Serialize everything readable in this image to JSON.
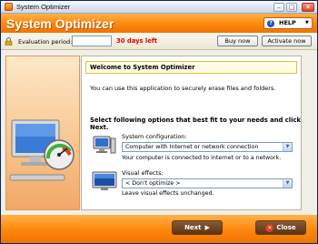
{
  "window": {
    "title": "System Optimizer",
    "controls": {
      "minimize": "–",
      "maximize": "□",
      "close": "✕"
    }
  },
  "header": {
    "app_title": "System Optimizer",
    "help_label": "HELP",
    "help_icon": "question-icon"
  },
  "evaluation": {
    "label": "Evaluation period:",
    "value": "",
    "days_left": "30 days left",
    "buy_label": "Buy now",
    "activate_label": "Activate now"
  },
  "content": {
    "welcome": "Welcome to System Optimizer",
    "intro": "You can use this application to securely erase files and folders.",
    "options_heading": "Select following options that best fit to your needs and click Next.",
    "system_config": {
      "label": "System configuration:",
      "selected": "Computer with Internet or network connection",
      "description": "Your computer is connected to internet or to a network."
    },
    "visual_effects": {
      "label": "Visual effects:",
      "selected": "< Don't optimize >",
      "description": "Leave visual effects unchanged."
    }
  },
  "footer": {
    "next_label": "Next",
    "close_label": "Close"
  },
  "colors": {
    "accent_orange": "#ff8a0f",
    "days_red": "#e00000",
    "welcome_bg": "#fffde3"
  }
}
